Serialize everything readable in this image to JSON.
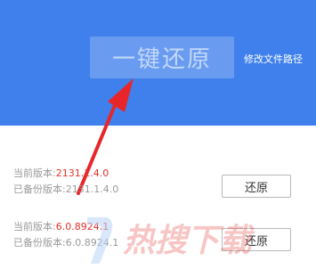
{
  "header": {
    "restore_all_label": "一键还原",
    "modify_path_label": "修改文件路径",
    "background_color": "#3f80ec"
  },
  "versions": [
    {
      "current_label": "当前版本:",
      "current_value": "2131.1.4.0",
      "backup_label": "已备份版本:",
      "backup_value": "2131.1.4.0",
      "restore_label": "还原"
    },
    {
      "current_label": "当前版本:",
      "current_value": "6.0.8924.1",
      "backup_label": "已备份版本:",
      "backup_value": "6.0.8924.1",
      "restore_label": "还原"
    }
  ],
  "annotation": {
    "arrow_color": "#e8262a",
    "icon": "red-arrow-icon"
  },
  "watermark": {
    "text": "热搜下载",
    "icon": "watermark-logo-icon"
  },
  "colors": {
    "accent_red": "#e5322d",
    "muted_text": "#999999"
  }
}
